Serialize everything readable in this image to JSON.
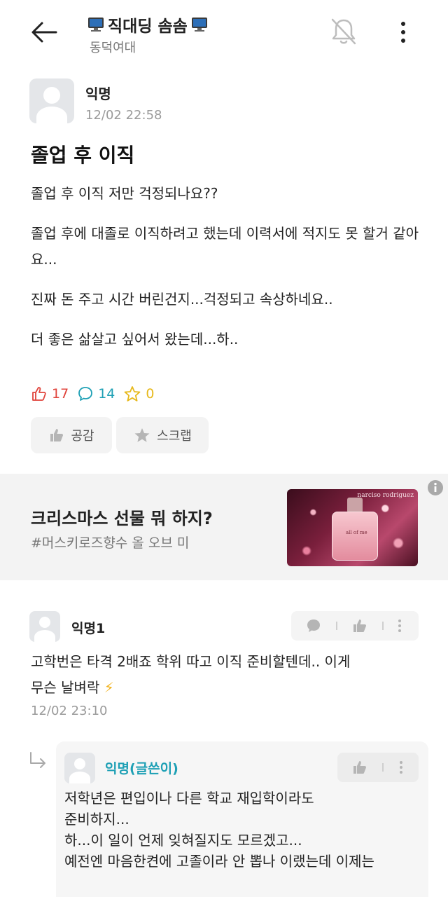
{
  "header": {
    "title": "직대딩 솜솜",
    "subtitle": "동덕여대",
    "icons": [
      "back-arrow-icon",
      "monitor-icon",
      "bell-off-icon",
      "more-vertical-icon"
    ]
  },
  "post": {
    "author": "익명",
    "time": "12/02 22:58",
    "title": "졸업 후 이직",
    "paragraphs": [
      "졸업 후 이직 저만 걱정되나요??",
      "졸업 후에 대졸로 이직하려고 했는데 이력서에 적지도 못 할거 같아요...",
      "진짜 돈 주고 시간 버린건지...걱정되고 속상하네요..",
      "더 좋은 삶살고 싶어서 왔는데...하.."
    ],
    "likes": "17",
    "comments": "14",
    "scraps": "0",
    "empathy_label": "공감",
    "scrap_label": "스크랩"
  },
  "ad": {
    "title": "크리스마스 선물 뭐 하지?",
    "subtitle": "#머스키로즈향수 올 오브 미",
    "brand": "narciso rodriguez",
    "product": "all of me"
  },
  "comment": {
    "author": "익명1",
    "text_line1": "고학번은 타격 2배죠 학위 따고 이직 준비할텐데.. 이게",
    "text_line2": "무슨 날벼락",
    "emoji": "⚡",
    "time": "12/02 23:10"
  },
  "reply": {
    "author": "익명(글쓴이)",
    "lines": [
      "저학년은 편입이나 다른 학교 재입학이라도",
      "준비하지...",
      "하...이 일이 언제 잊혀질지도 모르겠고...",
      "예전엔 마음한켠에 고졸이라 안 뽑나 이랬는데 이제는"
    ]
  },
  "colors": {
    "like": "#e0433b",
    "comment": "#1ea0b5",
    "scrap": "#e7b91c",
    "writer": "#1ea0b5"
  }
}
